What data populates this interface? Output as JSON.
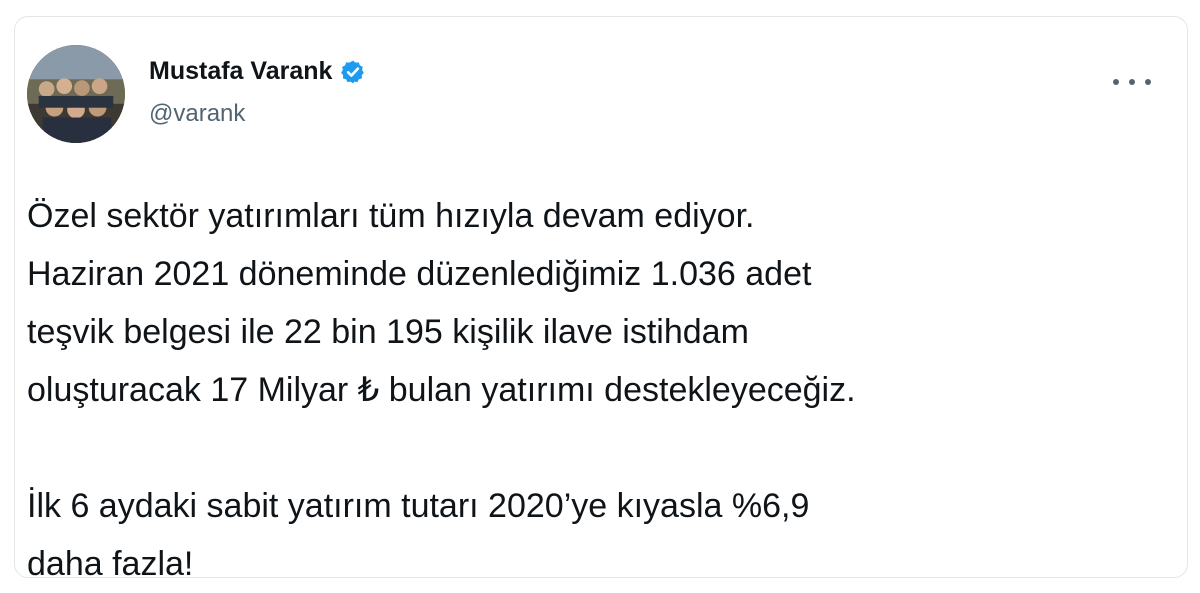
{
  "author": {
    "name": "Mustafa Varank",
    "handle": "@varank",
    "verified_icon": "verified-badge-icon"
  },
  "menu_icon": "more-options-icon",
  "colors": {
    "text": "#0f1419",
    "secondary": "#536471",
    "verified": "#1d9bf0",
    "border": "#e1e6ea"
  },
  "tweet": {
    "lines": [
      "Özel sektör yatırımları tüm hızıyla devam ediyor.",
      "Haziran 2021 döneminde düzenlediğimiz 1.036 adet",
      "teşvik belgesi ile 22 bin 195 kişilik ilave istihdam",
      "oluşturacak 17 Milyar ₺ bulan yatırımı destekleyeceğiz.",
      "İlk 6 aydaki sabit yatırım tutarı 2020’ye kıyasla %6,9",
      "daha fazla!"
    ]
  }
}
